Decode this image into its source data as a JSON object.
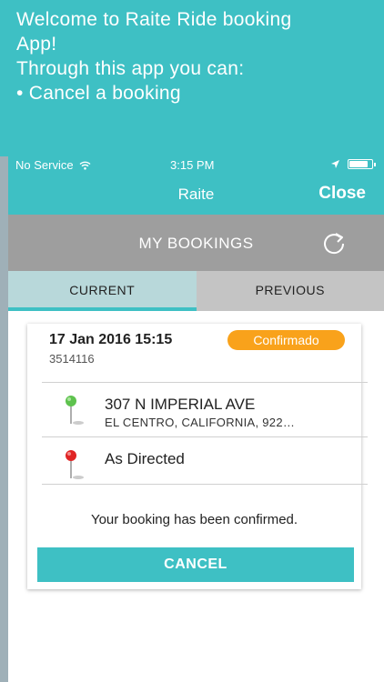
{
  "promo": {
    "line1": "Welcome to Raite Ride booking",
    "line2": "App!",
    "line3": "Through this app you can:",
    "line4": "• Cancel a booking"
  },
  "statusbar": {
    "carrier": "No Service",
    "time": "3:15 PM",
    "battery_level": 0.85,
    "icons": [
      "wifi-icon",
      "location-arrow-icon",
      "battery-icon"
    ]
  },
  "navbar": {
    "title": "Raite",
    "close_label": "Close"
  },
  "header": {
    "title": "MY BOOKINGS",
    "refresh_icon": "refresh-icon"
  },
  "tabs": [
    {
      "label": "CURRENT",
      "active": true
    },
    {
      "label": "PREVIOUS",
      "active": false
    }
  ],
  "booking": {
    "datetime": "17 Jan 2016 15:15",
    "reference": "3514116",
    "status": "Confirmado",
    "pickup": {
      "address": "307 N IMPERIAL AVE",
      "subtitle": "EL CENTRO,  CALIFORNIA,  922…",
      "icon": "green-pin-icon"
    },
    "dropoff": {
      "address": "As Directed",
      "icon": "red-pin-icon"
    },
    "message": "Your booking has been confirmed.",
    "cancel_label": "CANCEL"
  },
  "colors": {
    "accent": "#3ec0c4",
    "badge": "#f9a21b",
    "header": "#9e9e9e"
  }
}
